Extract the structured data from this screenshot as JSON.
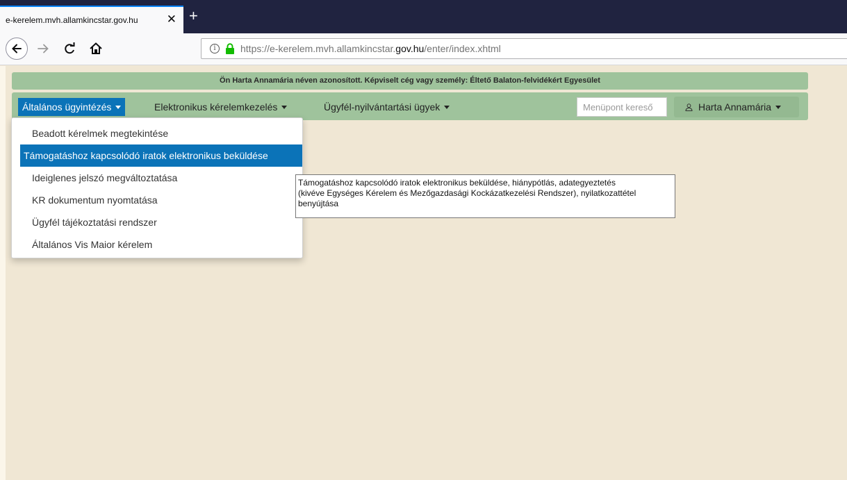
{
  "browser": {
    "tab_title": "e-kerelem.mvh.allamkincstar.gov.hu",
    "tab_close": "✕",
    "new_tab": "+",
    "url_prefix": "https://e-kerelem.mvh.allamkincstar.",
    "url_host": "gov.hu",
    "url_path": "/enter/index.xhtml"
  },
  "identity_bar": {
    "text": "Ön Harta Annamária néven azonosított.  Képviselt cég vagy személy: Éltető Balaton-felvidékért Egyesület"
  },
  "menu": {
    "items": [
      {
        "label": "Általános ügyintézés"
      },
      {
        "label": "Elektronikus kérelemkezelés"
      },
      {
        "label": "Ügyfél-nyilvántartási ügyek"
      }
    ],
    "search_placeholder": "Menüpont kereső",
    "user_label": "Harta Annamária",
    "user_icon": "user-icon"
  },
  "dropdown": {
    "items": [
      {
        "label": "Beadott kérelmek megtekintése"
      },
      {
        "label": "Támogatáshoz kapcsolódó iratok elektronikus beküldése"
      },
      {
        "label": "Ideiglenes jelszó megváltoztatása"
      },
      {
        "label": "KR dokumentum nyomtatása"
      },
      {
        "label": "Ügyfél tájékoztatási rendszer"
      },
      {
        "label": "Általános Vis Maior kérelem"
      }
    ]
  },
  "tooltip": {
    "line1": "Támogatáshoz kapcsolódó iratok elektronikus beküldése, hiánypótlás, adategyeztetés",
    "line2": "(kivéve Egységes Kérelem és Mezőgazdasági Kockázatkezelési Rendszer), nyilatkozattétel",
    "line3": "benyújtása"
  },
  "colors": {
    "menu_green": "#9fc39c",
    "active_blue": "#0b73b8",
    "page_bg": "#f0e7d4"
  }
}
